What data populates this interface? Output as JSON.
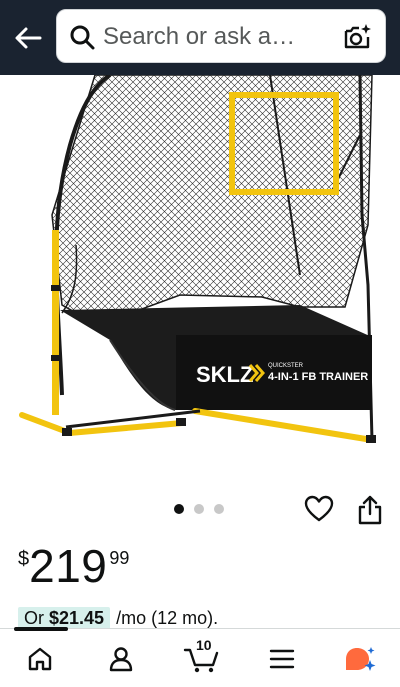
{
  "search": {
    "placeholder": "Search or ask a…"
  },
  "product": {
    "image_alt": "SKLZ Quickster 4-in-1 FB Trainer net",
    "brand_text": "SKLZ",
    "net_label_small": "QUICKSTER",
    "net_label_large": "4-IN-1 FB TRAINER"
  },
  "carousel": {
    "total": 3,
    "active_index": 0
  },
  "price": {
    "symbol": "$",
    "whole": "219",
    "fraction": "99"
  },
  "monthly": {
    "or": "Or",
    "amount": "$21.45",
    "rest": "/mo (12 mo)."
  },
  "nav": {
    "cart_count": "10"
  },
  "colors": {
    "header_bg": "#1a2330",
    "accent_yellow": "#f2c40f",
    "monthly_pill": "#d7f0ec"
  },
  "icons": [
    "back-arrow-icon",
    "search-icon",
    "camera-icon",
    "heart-icon",
    "share-icon",
    "home-icon",
    "account-icon",
    "cart-icon",
    "menu-icon",
    "rufus-icon"
  ]
}
